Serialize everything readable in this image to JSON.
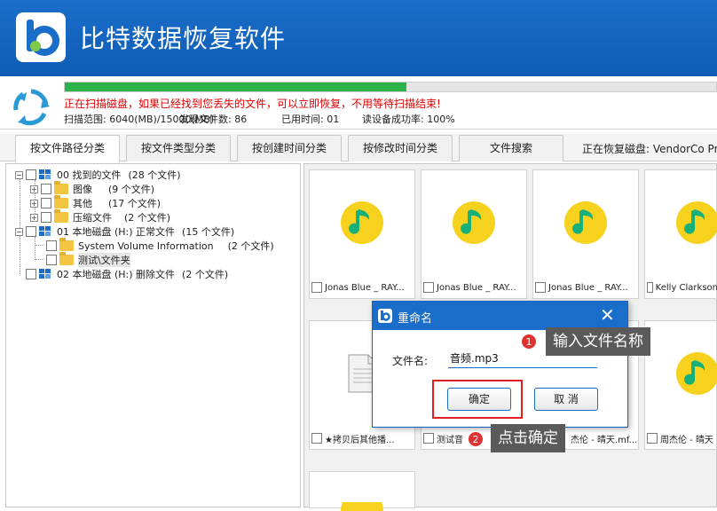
{
  "app": {
    "title": "比特数据恢复软件"
  },
  "colors": {
    "brand": "#1a6ec9",
    "progress": "#2bb34a",
    "alert": "#e00000",
    "highlight": "#e02020"
  },
  "scan": {
    "progress_fraction": 0.525,
    "message": "正在扫描磁盘，如果已经找到您丢失的文件，可以立即恢复，不用等待扫描结束!",
    "range": "扫描范围: 6040(MB)/15000(MB)",
    "found": "发现文件数: 86",
    "elapsed": "已用时间: 01",
    "success_rate": "读设备成功率: 100%"
  },
  "tabs": [
    {
      "label": "按文件路径分类"
    },
    {
      "label": "按文件类型分类"
    },
    {
      "label": "按创建时间分类"
    },
    {
      "label": "按修改时间分类"
    },
    {
      "label": "文件搜索"
    }
  ],
  "recovering_disk": "正在恢复磁盘: VendorCo Prod",
  "tree": [
    {
      "label": "00 找到的文件",
      "count": "(28 个文件)"
    },
    {
      "label": "图像",
      "count": "(9 个文件)"
    },
    {
      "label": "其他",
      "count": "(17 个文件)"
    },
    {
      "label": "压缩文件",
      "count": "(2 个文件)"
    },
    {
      "label": "01 本地磁盘 (H:) 正常文件",
      "count": "(15 个文件)"
    },
    {
      "label": "System Volume Information",
      "count": "(2 个文件)"
    },
    {
      "label": "测试\\文件夹",
      "count": ""
    },
    {
      "label": "02 本地磁盘 (H:) 删除文件",
      "count": "(2 个文件)"
    }
  ],
  "cards": [
    {
      "label": "Jonas Blue _ RAY...",
      "icon": "music-note-icon"
    },
    {
      "label": "Jonas Blue _ RAY...",
      "icon": "music-note-icon"
    },
    {
      "label": "Jonas Blue _ RAY...",
      "icon": "music-note-icon"
    },
    {
      "label": "Kelly Clarkson",
      "icon": "music-note-icon"
    },
    {
      "label": "★拷贝后其他播...",
      "icon": "document-icon"
    },
    {
      "label": "测试音",
      "icon": "music-note-icon"
    },
    {
      "label": "杰伦 - 晴天.mf...",
      "icon": "music-note-icon"
    },
    {
      "label": "周杰伦 - 晴天",
      "icon": "music-note-icon"
    }
  ],
  "dialog": {
    "title": "重命名",
    "field_label": "文件名:",
    "filename_value": "音频.mp3",
    "ok_label": "确定",
    "cancel_label": "取 消"
  },
  "annotations": {
    "step1_number": "1",
    "step1_text": "输入文件名称",
    "step2_number": "2",
    "step2_text": "点击确定"
  }
}
